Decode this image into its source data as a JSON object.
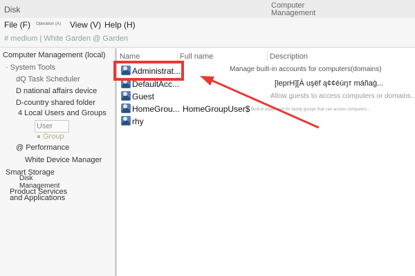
{
  "window": {
    "title_left": "Disk",
    "title_right": "Computer Management"
  },
  "menu": {
    "file": "File (F)",
    "operation": "Operation (A)",
    "view": "View (V)",
    "help": "Help (H)"
  },
  "toolbar": {
    "breadcrumb": "# medium | White Garden @ Garden"
  },
  "left_tree": {
    "root": "Computer Management (local)",
    "system_tools": "System Tools",
    "task_scheduler": "dQ Task Scheduler",
    "national_affairs_device": "D national affairs device",
    "shared_folder": "D-country shared folder",
    "local_users_groups": "4 Local Users and Groups",
    "user": "User",
    "group": "Group",
    "performance": "@ Performance",
    "device_manager": "White Device Manager",
    "smart_storage": "Smart Storage",
    "disk_management": "Disk Management",
    "product_services": "Product Services",
    "and_applications": "and Applications"
  },
  "list": {
    "headers": [
      "Name",
      "Full name",
      "Description"
    ],
    "rows": [
      {
        "name": "Administrat...",
        "fullname": "",
        "description": "Manage built-in accounts for computers(domains)"
      },
      {
        "name": "DefaultAcc...",
        "fullname": "",
        "description": "[leprH][À uşëf ą¢¢éúŋт máñaģ..."
      },
      {
        "name": "Guest",
        "fullname": "",
        "description": "Allow guests to access computers or domains..."
      },
      {
        "name": "HomeGrou...",
        "fullname": "HomeGroupUser$",
        "description": "Built-in equipment for family groups that can access computers..."
      },
      {
        "name": "rhy",
        "fullname": "",
        "description": ""
      }
    ]
  },
  "colors": {
    "highlight": "#e73a34",
    "arrow": "#e73a34",
    "user_icon": "#5a7fb3"
  }
}
